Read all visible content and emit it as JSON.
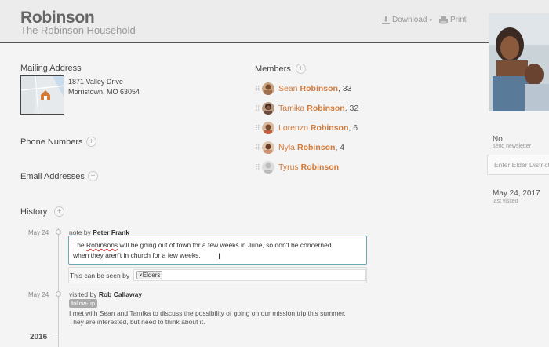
{
  "header": {
    "family_name": "Robinson",
    "household_name": "The Robinson Household",
    "download_label": "Download",
    "print_label": "Print"
  },
  "mailing": {
    "title": "Mailing Address",
    "street": "1871 Valley Drive",
    "city_line": "Morristown, MO  63054"
  },
  "sections": {
    "phone_numbers": "Phone Numbers",
    "email_addresses": "Email Addresses",
    "history": "History",
    "members": "Members"
  },
  "members": [
    {
      "first": "Sean",
      "last": "Robinson",
      "age": ", 33"
    },
    {
      "first": "Tamika",
      "last": "Robinson",
      "age": ", 32"
    },
    {
      "first": "Lorenzo",
      "last": "Robinson",
      "age": ", 6"
    },
    {
      "first": "Nyla",
      "last": "Robinson",
      "age": ", 4"
    },
    {
      "first": "Tyrus",
      "last": "Robinson",
      "age": ""
    }
  ],
  "history": {
    "entries": [
      {
        "date": "May 24",
        "kind": "note by",
        "author": "Peter Frank",
        "text_pre": "The ",
        "text_underlined": "Robinsons",
        "text_line1_rest": " will be going out of town for a few weeks in June, so don't be concerned",
        "text_line2": "when they aren't in church for a few weeks.",
        "visibility_label": "This can be seen by",
        "visibility_chip": "Elders"
      },
      {
        "date": "May 24",
        "kind": "visited by",
        "author": "Rob Callaway",
        "tag": "follow-up",
        "text_line1": "I met with Sean and Tamika to discuss the possibility of going on our mission trip this summer.",
        "text_line2": "They are interested, but need to think about it."
      }
    ],
    "year": "2016"
  },
  "sidebar": {
    "newsletter_value": "No",
    "newsletter_label": "send newsletter",
    "elder_placeholder": "Enter Elder District",
    "last_visited_value": "May 24, 2017",
    "last_visited_label": "last visited"
  },
  "colors": {
    "accent": "#d27a3a",
    "focus_border": "#6aa9b8"
  }
}
